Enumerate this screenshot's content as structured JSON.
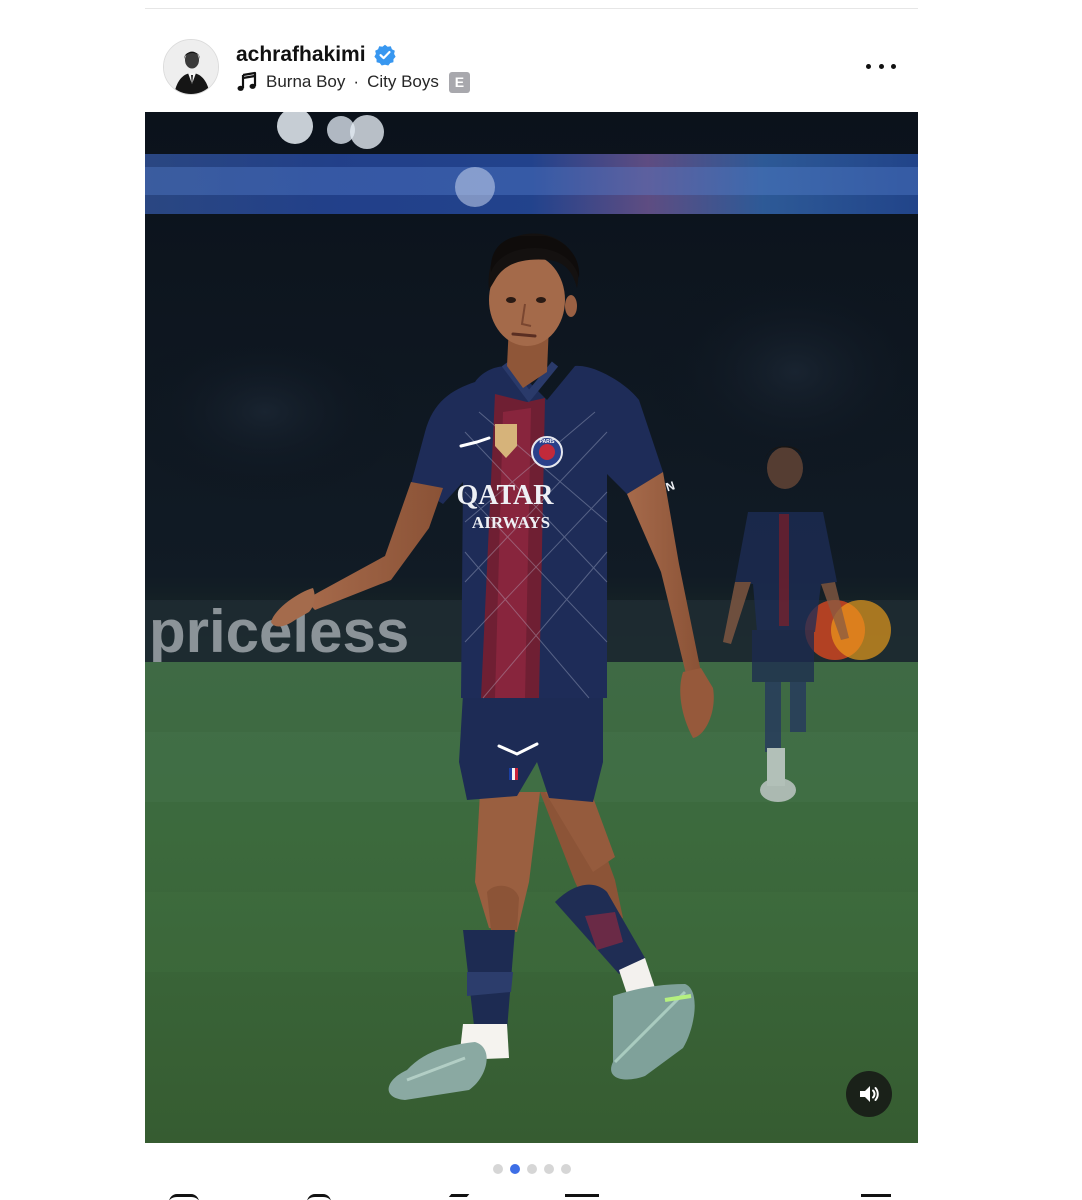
{
  "post": {
    "username": "achrafhakimi",
    "verified": true,
    "music": {
      "artist": "Burna Boy",
      "separator": "·",
      "track": "City Boys",
      "explicit_label": "E"
    },
    "media": {
      "sponsor_board_text": "priceless",
      "jersey_sponsor_line1": "QATAR",
      "jersey_sponsor_line2": "AIRWAYS",
      "sleeve_text": "BEYON",
      "club_badge_text": "PARIS"
    },
    "carousel": {
      "count": 5,
      "active_index": 1
    }
  },
  "icons": {
    "verified": "verified-badge-icon",
    "music": "music-note-icon",
    "more": "more-options-icon",
    "sound": "speaker-icon"
  },
  "colors": {
    "verified_blue": "#3897f0",
    "active_dot": "#3d6ee6",
    "inactive_dot": "#d6d6d6"
  }
}
